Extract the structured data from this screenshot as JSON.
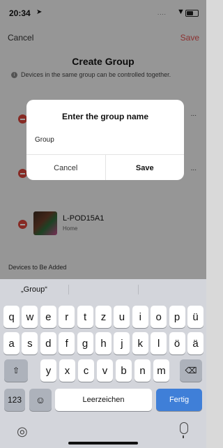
{
  "status": {
    "time": "20:34",
    "location_arrow": "➤",
    "signal_dots": "....",
    "wifi_glyph": "▼"
  },
  "nav": {
    "cancel": "Cancel",
    "save": "Save"
  },
  "page": {
    "title": "Create Group",
    "hint": "Devices in the same group can be controlled together.",
    "devices": [
      {
        "name": "",
        "sub": "",
        "trunc": "..."
      },
      {
        "name": "",
        "sub": "",
        "trunc": "..."
      },
      {
        "name": "L-POD15A1",
        "sub": "Home",
        "trunc": ""
      }
    ],
    "section_label": "Devices to Be Added"
  },
  "dialog": {
    "title": "Enter the group name",
    "value": "Group",
    "cancel": "Cancel",
    "save": "Save"
  },
  "keyboard": {
    "suggestion": "„Group“",
    "row1": [
      "q",
      "w",
      "e",
      "r",
      "t",
      "z",
      "u",
      "i",
      "o",
      "p",
      "ü"
    ],
    "row2": [
      "a",
      "s",
      "d",
      "f",
      "g",
      "h",
      "j",
      "k",
      "l",
      "ö",
      "ä"
    ],
    "row3": [
      "y",
      "x",
      "c",
      "v",
      "b",
      "n",
      "m"
    ],
    "shift": "⇧",
    "backspace": "⌫",
    "numbers": "123",
    "emoji": "☺",
    "space": "Leerzeichen",
    "return": "Fertig",
    "globe": "◎"
  },
  "colors": {
    "accent_red": "#e05050",
    "return_blue": "#3f7fd8"
  }
}
